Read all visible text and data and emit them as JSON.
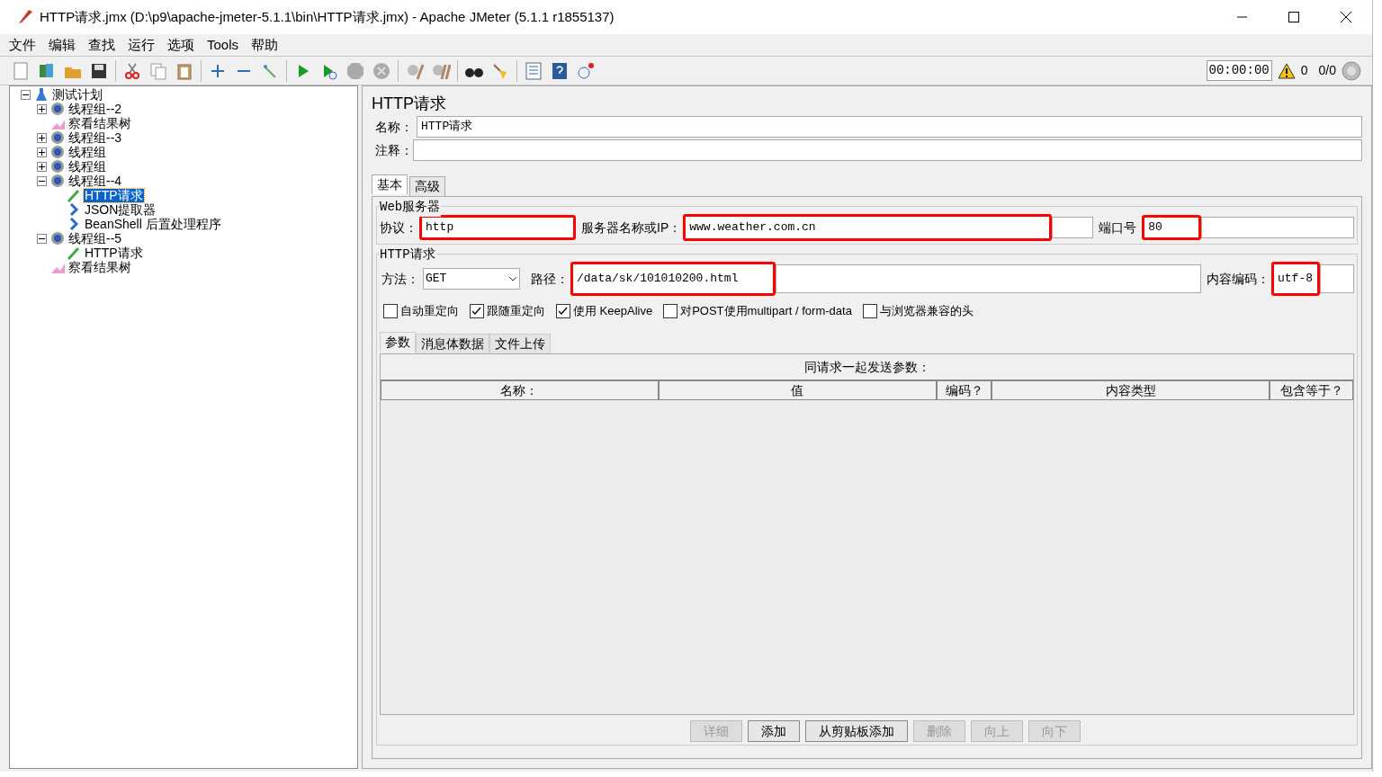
{
  "window": {
    "title": "HTTP请求.jmx (D:\\p9\\apache-jmeter-5.1.1\\bin\\HTTP请求.jmx) - Apache JMeter (5.1.1 r1855137)"
  },
  "menu": [
    "文件",
    "编辑",
    "查找",
    "运行",
    "选项",
    "Tools",
    "帮助"
  ],
  "status": {
    "timer": "00:00:00",
    "warnings": "0",
    "threads": "0/0"
  },
  "tree": [
    {
      "label": "测试计划",
      "kind": "plan",
      "expanded": true,
      "selected": false,
      "children": [
        {
          "label": "线程组--2",
          "kind": "thread-group",
          "expanded": false,
          "selected": false
        },
        {
          "label": "察看结果树",
          "kind": "listener",
          "selected": false
        },
        {
          "label": "线程组--3",
          "kind": "thread-group",
          "expanded": false,
          "selected": false
        },
        {
          "label": "线程组",
          "kind": "thread-group",
          "expanded": false,
          "selected": false
        },
        {
          "label": "线程组",
          "kind": "thread-group",
          "expanded": false,
          "selected": false
        },
        {
          "label": "线程组--4",
          "kind": "thread-group",
          "expanded": true,
          "selected": false,
          "children": [
            {
              "label": "HTTP请求",
              "kind": "sampler",
              "selected": true
            },
            {
              "label": "JSON提取器",
              "kind": "post-processor",
              "selected": false
            },
            {
              "label": "BeanShell 后置处理程序",
              "kind": "post-processor",
              "selected": false
            }
          ]
        },
        {
          "label": "线程组--5",
          "kind": "thread-group",
          "expanded": true,
          "selected": false,
          "children": [
            {
              "label": "HTTP请求",
              "kind": "sampler",
              "selected": false
            }
          ]
        },
        {
          "label": "察看结果树",
          "kind": "listener",
          "selected": false
        }
      ]
    }
  ],
  "panel": {
    "title": "HTTP请求",
    "name": {
      "label": "名称：",
      "value": "HTTP请求"
    },
    "comment": {
      "label": "注释："
    },
    "tabs": [
      {
        "label": "基本",
        "selected": true
      },
      {
        "label": "高级",
        "selected": false
      }
    ],
    "web_server": {
      "legend": "Web服务器",
      "protocol": {
        "label": "协议：",
        "value": "http",
        "highlighted": true
      },
      "server": {
        "label": "服务器名称或IP：",
        "value": "www.weather.com.cn",
        "highlighted": true
      },
      "port": {
        "label": "端口号",
        "value": "80",
        "highlighted": true
      }
    },
    "http_request": {
      "legend": "HTTP请求",
      "method": {
        "label": "方法：",
        "value": "GET"
      },
      "path": {
        "label": "路径：",
        "value": "/data/sk/101010200.html",
        "highlighted": true
      },
      "encoding": {
        "label": "内容编码：",
        "value": "utf-8",
        "highlighted": true
      },
      "options": [
        {
          "label": "自动重定向",
          "checked": false
        },
        {
          "label": "跟随重定向",
          "checked": true
        },
        {
          "label": "使用 KeepAlive",
          "checked": true
        },
        {
          "label": "对POST使用multipart / form-data",
          "checked": false
        },
        {
          "label": "与浏览器兼容的头",
          "checked": false
        }
      ],
      "subtabs": [
        {
          "label": "参数",
          "selected": true
        },
        {
          "label": "消息体数据",
          "selected": false
        },
        {
          "label": "文件上传",
          "selected": false
        }
      ],
      "table_caption": "同请求一起发送参数：",
      "columns": [
        "名称：",
        "值",
        "编码？",
        "内容类型",
        "包含等于？"
      ],
      "buttons": [
        {
          "label": "详细",
          "disabled": true
        },
        {
          "label": "添加",
          "disabled": false
        },
        {
          "label": "从剪贴板添加",
          "disabled": false
        },
        {
          "label": "删除",
          "disabled": true
        },
        {
          "label": "向上",
          "disabled": true
        },
        {
          "label": "向下",
          "disabled": true
        }
      ]
    }
  }
}
